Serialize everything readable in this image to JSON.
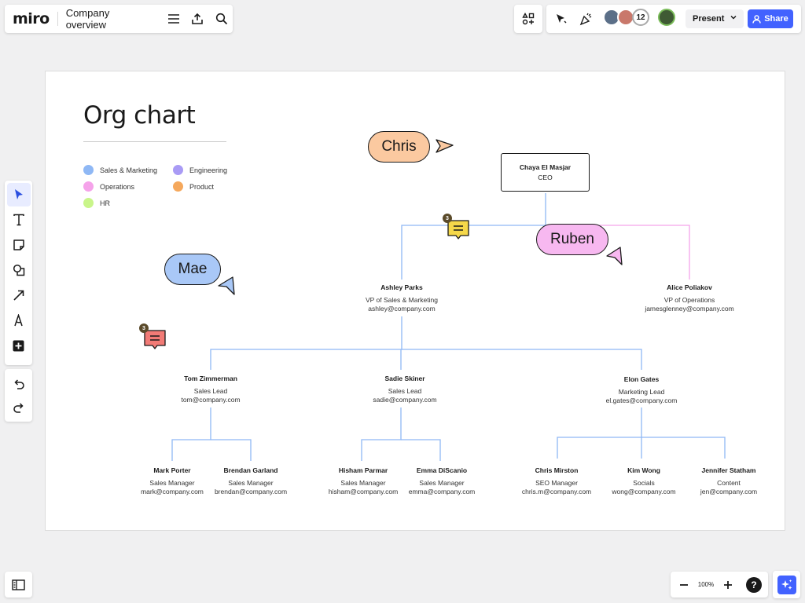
{
  "app": {
    "logo": "miro",
    "board_name": "Company overview"
  },
  "topbar": {
    "collaborator_count": "12",
    "present_label": "Present",
    "share_label": "Share"
  },
  "board": {
    "title": "Org chart",
    "legend": [
      {
        "label": "Sales & Marketing",
        "color": "#8fb8f5"
      },
      {
        "label": "Engineering",
        "color": "#a99bf5"
      },
      {
        "label": "Operations",
        "color": "#f5a3ea"
      },
      {
        "label": "Product",
        "color": "#f5a85c"
      },
      {
        "label": "HR",
        "color": "#c9f58a"
      }
    ],
    "ceo": {
      "name": "Chaya El Masjar",
      "role": "CEO"
    },
    "vps": [
      {
        "name": "Ashley Parks",
        "role": "VP of Sales & Marketing",
        "email": "ashley@company.com"
      },
      {
        "name": "Alice Poliakov",
        "role": "VP of Operations",
        "email": "jamesglenney@company.com"
      }
    ],
    "leads": [
      {
        "name": "Tom Zimmerman",
        "role": "Sales Lead",
        "email": "tom@company.com"
      },
      {
        "name": "Sadie Skiner",
        "role": "Sales Lead",
        "email": "sadie@company.com"
      },
      {
        "name": "Elon Gates",
        "role": "Marketing Lead",
        "email": "el.gates@company.com"
      }
    ],
    "staff": [
      {
        "name": "Mark Porter",
        "role": "Sales Manager",
        "email": "mark@company.com"
      },
      {
        "name": "Brendan Garland",
        "role": "Sales Manager",
        "email": "brendan@company.com"
      },
      {
        "name": "Hisham Parmar",
        "role": "Sales Manager",
        "email": "hisham@company.com"
      },
      {
        "name": "Emma DiScanio",
        "role": "Sales Manager",
        "email": "emma@company.com"
      },
      {
        "name": "Chris Mirston",
        "role": "SEO Manager",
        "email": "chris.m@company.com"
      },
      {
        "name": "Kim Wong",
        "role": "Socials",
        "email": "wong@company.com"
      },
      {
        "name": "Jennifer Statham",
        "role": "Content",
        "email": "jen@company.com"
      }
    ],
    "cursors": [
      {
        "name": "Chris",
        "color": "#fbc9a0"
      },
      {
        "name": "Ruben",
        "color": "#f7b8f0"
      },
      {
        "name": "Mae",
        "color": "#a9c8f7"
      }
    ],
    "comments": [
      {
        "count": "3",
        "color": "#f5d84a"
      },
      {
        "count": "3",
        "color": "#f27b76"
      }
    ]
  },
  "zoom": {
    "level": "100%"
  },
  "help_label": "?"
}
